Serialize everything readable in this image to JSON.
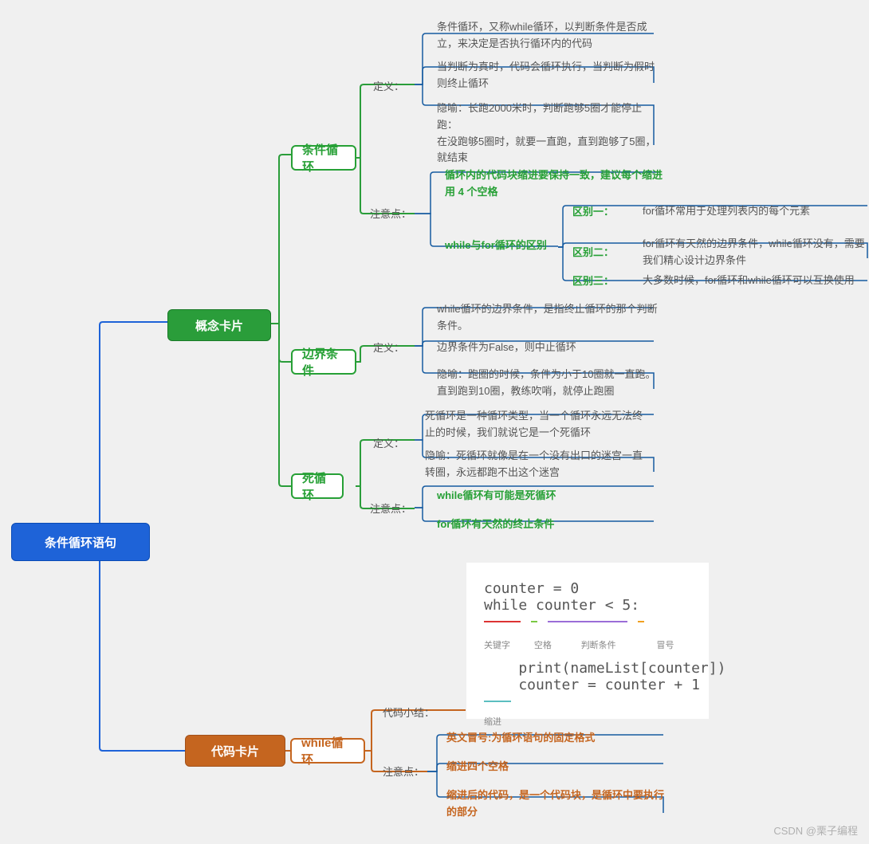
{
  "root": "条件循环语句",
  "concept_card": "概念卡片",
  "code_card": "代码卡片",
  "cond_loop": "条件循环",
  "boundary": "边界条件",
  "dead_loop": "死循环",
  "while_loop": "while循环",
  "def_lbl": "定义：",
  "note_lbl": "注意点：",
  "code_sum_lbl": "代码小结：",
  "cl_def1": "条件循环，又称while循环，以判断条件是否成立，来决定是否执行循环内的代码",
  "cl_def2": "当判断为真时，代码会循环执行，当判断为假时则终止循环",
  "cl_def3": "隐喻：长跑2000米时，判断跑够5圈才能停止跑：\n在没跑够5圈时，就要一直跑，直到跑够了5圈，就结束",
  "cl_note1": "循环内的代码块缩进要保持一致，建议每个缩进用 4 个空格",
  "cl_note2": "while与for循环的区别",
  "diff1": "区别一：",
  "diff1_t": "for循环常用于处理列表内的每个元素",
  "diff2": "区别二：",
  "diff2_t": "for循环有天然的边界条件，while循环没有，需要我们精心设计边界条件",
  "diff3": "区别三：",
  "diff3_t": "大多数时候，for循环和while循环可以互换使用",
  "bd_def1": "while循环的边界条件，是指终止循环的那个判断条件。",
  "bd_def2": "边界条件为False，则中止循环",
  "bd_def3": "隐喻：跑圈的时候，条件为小于10圈就一直跑。直到跑到10圈，教练吹哨，就停止跑圈",
  "dl_def1": "死循环是一种循环类型，当一个循环永远无法终止的时候，我们就说它是一个死循环",
  "dl_def2": "隐喻：死循环就像是在一个没有出口的迷宫一直转圈，永远都跑不出这个迷宫",
  "dl_note1": "while循环有可能是死循环",
  "dl_note2": "for循环有天然的终止条件",
  "wl_n1": "英文冒号:为循环语句的固定格式",
  "wl_n2": "缩进四个空格",
  "wl_n3": "缩进后的代码，是一个代码块，是循环中要执行的部分",
  "code": {
    "l1": "counter = 0",
    "l2": "while counter < 5:",
    "l3": "    print(nameList[counter])",
    "l4": "    counter = counter + 1",
    "kw": "关键字",
    "sp": "空格",
    "cond": "判断条件",
    "colon": "冒号",
    "indent": "缩进"
  },
  "footer": "CSDN @栗子编程"
}
